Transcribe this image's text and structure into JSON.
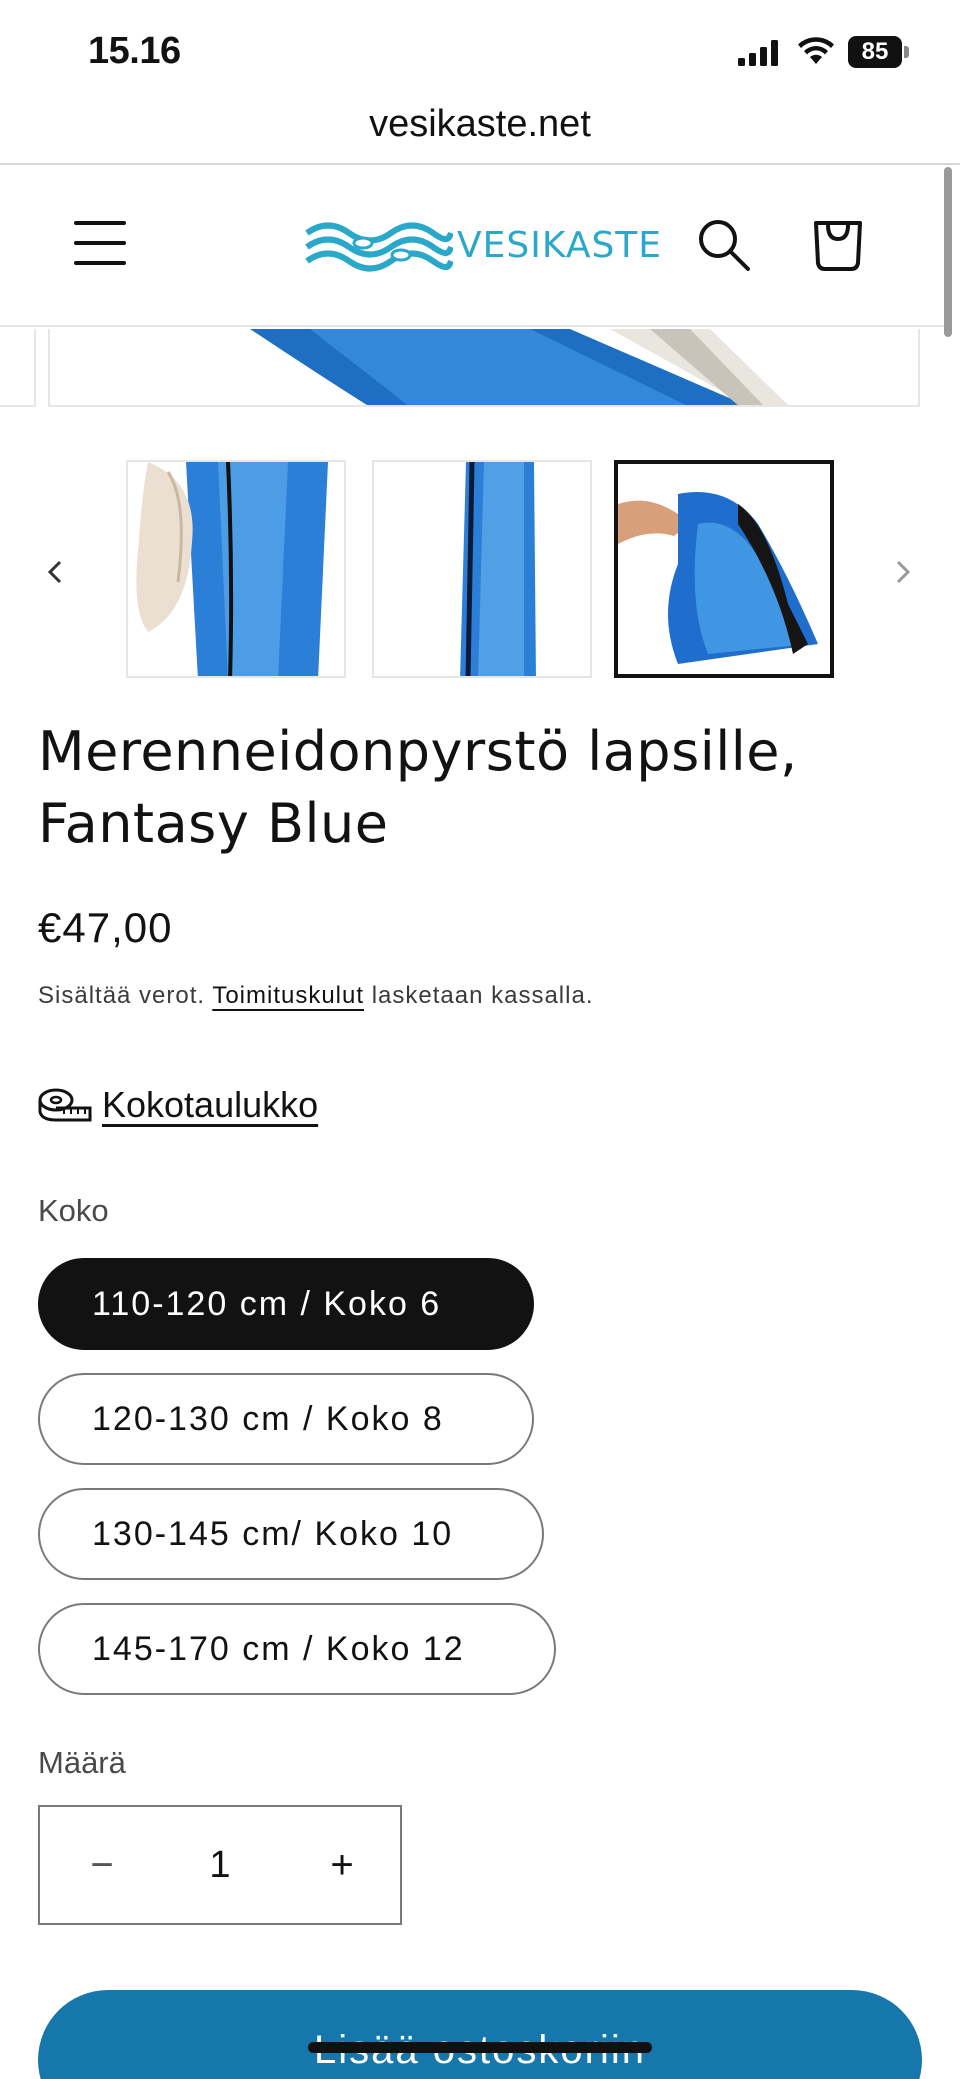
{
  "status_bar": {
    "time": "15.16",
    "battery": "85"
  },
  "browser": {
    "url": "vesikaste.net"
  },
  "header": {
    "logo_text": "VESIKASTE"
  },
  "product": {
    "title": "Merenneidonpyrstö lapsille, Fantasy Blue",
    "price": "€47,00",
    "tax_prefix": "Sisältää verot.",
    "tax_link": "Toimituskulut",
    "tax_suffix": "lasketaan kassalla.",
    "size_chart_link": "Kokotaulukko",
    "size_label": "Koko",
    "sizes": [
      {
        "label": "110-120 cm / Koko 6",
        "selected": true
      },
      {
        "label": "120-130 cm / Koko 8",
        "selected": false
      },
      {
        "label": "130-145 cm/ Koko 10",
        "selected": false
      },
      {
        "label": "145-170 cm / Koko 12",
        "selected": false
      }
    ],
    "quantity_label": "Määrä",
    "quantity": "1",
    "minus": "−",
    "plus": "+",
    "add_to_cart": "Lisää ostoskoriin"
  },
  "thumbnails": {
    "selected_index": 2,
    "count": 3
  },
  "colors": {
    "brand_blue": "#2aa8c9",
    "button_blue": "#1577ab",
    "dark": "#121212"
  }
}
